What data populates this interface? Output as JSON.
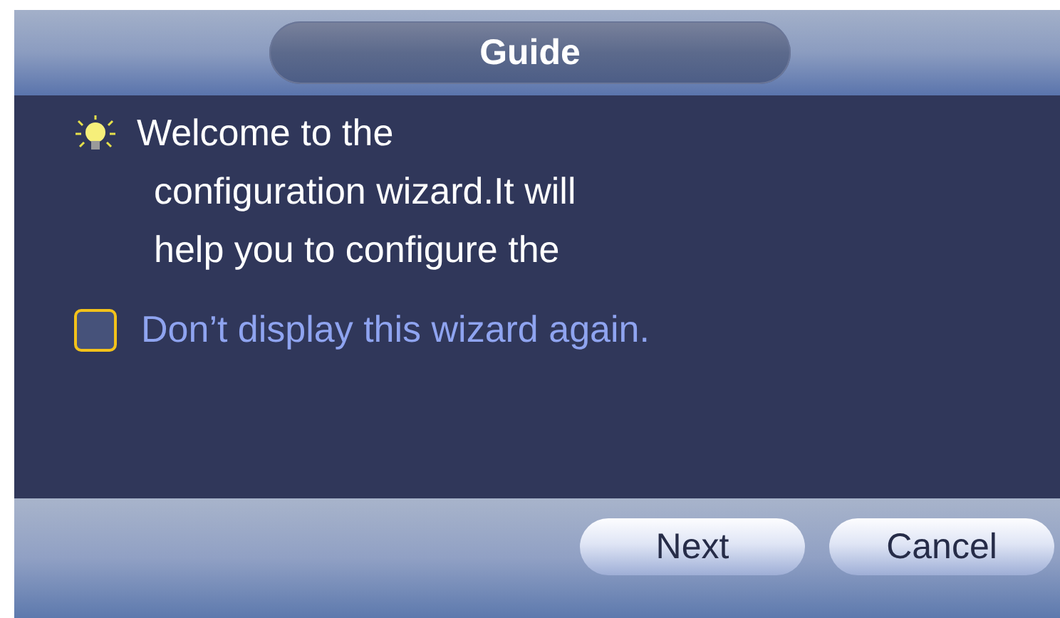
{
  "window": {
    "title": "Guide"
  },
  "message_lines": [
    "Welcome to the",
    "configuration wizard.It will",
    "help you to configure the"
  ],
  "checkbox": {
    "label": "Don’t display this wizard again.",
    "checked": false
  },
  "buttons": [
    {
      "label": "Next"
    },
    {
      "label": "Cancel"
    }
  ]
}
